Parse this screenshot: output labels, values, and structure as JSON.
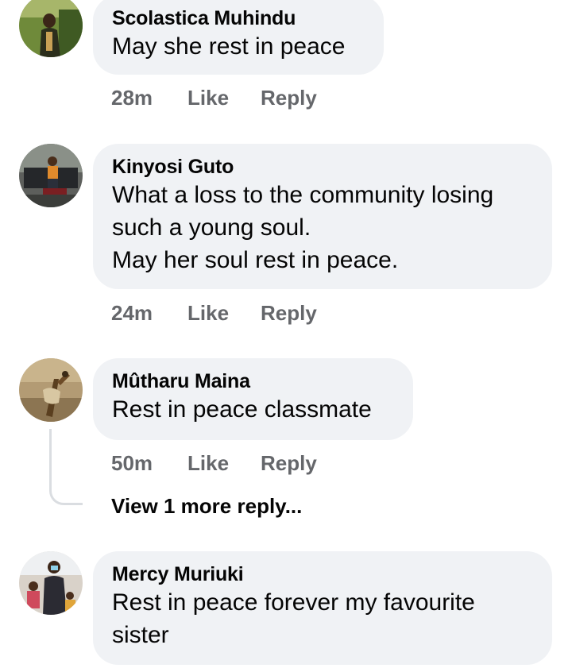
{
  "comments": [
    {
      "author": "Scolastica Muhindu",
      "text": "May she rest in peace",
      "time": "28m",
      "like": "Like",
      "reply": "Reply"
    },
    {
      "author": "Kinyosi Guto",
      "text": "What a loss to the community losing\nsuch a young soul.\nMay her soul rest in peace.",
      "time": "24m",
      "like": "Like",
      "reply": "Reply"
    },
    {
      "author": "Mûtharu Maina",
      "text": "Rest in peace classmate",
      "time": "50m",
      "like": "Like",
      "reply": "Reply",
      "view_more": "View 1 more reply..."
    },
    {
      "author": "Mercy Muriuki",
      "text": "Rest in peace forever my favourite\nsister"
    }
  ],
  "colors": {
    "bubble": "#f0f2f5",
    "meta": "#65676b",
    "text": "#050505",
    "thread_line": "#dadde1"
  }
}
